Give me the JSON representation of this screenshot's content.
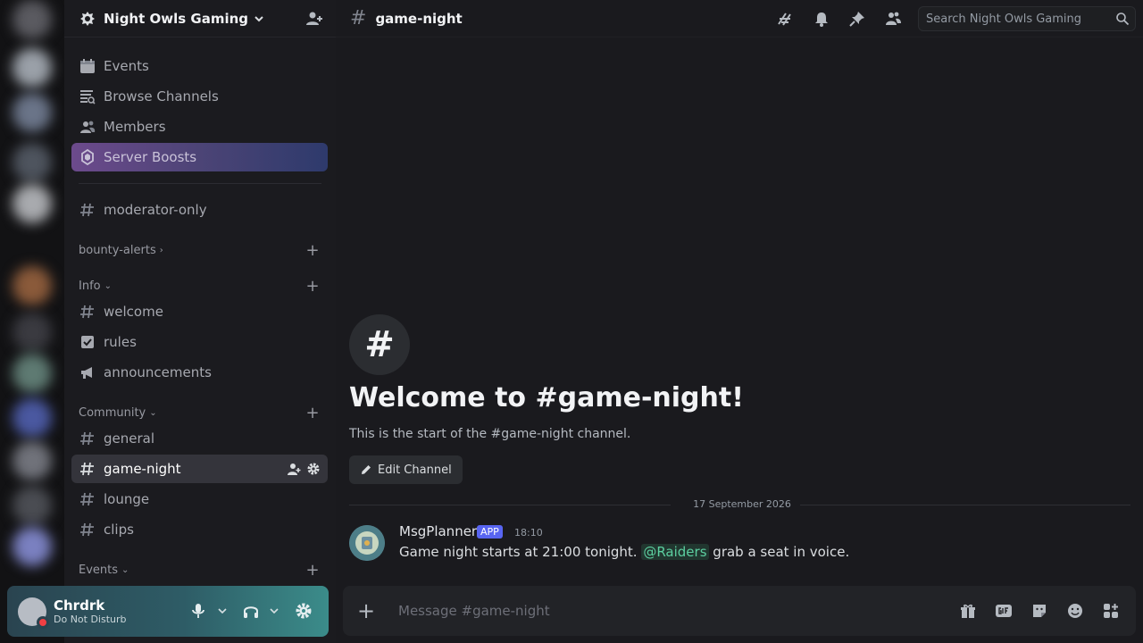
{
  "server": {
    "name": "Night Owls Gaming"
  },
  "nav": [
    {
      "label": "Events",
      "icon": "calendar-icon"
    },
    {
      "label": "Browse Channels",
      "icon": "browse-channels-icon"
    },
    {
      "label": "Members",
      "icon": "members-icon"
    },
    {
      "label": "Server Boosts",
      "icon": "boost-icon"
    }
  ],
  "channels": {
    "top": {
      "label": "moderator-only"
    },
    "categories": [
      {
        "label": "bounty-alerts",
        "chevron": "›"
      },
      {
        "label": "Info",
        "chevron": "⌄"
      },
      {
        "label": "Community",
        "chevron": "⌄"
      },
      {
        "label": "Events",
        "chevron": "⌄"
      }
    ],
    "info": [
      {
        "label": "welcome",
        "icon": "hash-icon"
      },
      {
        "label": "rules",
        "icon": "rules-icon"
      },
      {
        "label": "announcements",
        "icon": "megaphone-icon"
      }
    ],
    "community": [
      {
        "label": "general"
      },
      {
        "label": "game-night"
      },
      {
        "label": "lounge"
      },
      {
        "label": "clips"
      }
    ]
  },
  "user": {
    "name": "Chrdrk",
    "status": "Do Not Disturb"
  },
  "topbar": {
    "channel": "game-night",
    "search_placeholder": "Search Night Owls Gaming"
  },
  "welcome": {
    "hash": "#",
    "title": "Welcome to #game-night!",
    "subtitle": "This is the start of the #game-night channel.",
    "edit_label": "Edit Channel"
  },
  "date_divider": "17 September 2026",
  "message": {
    "author": "MsgPlanner",
    "badge": "APP",
    "time": "18:10",
    "text_before": "Game night starts at 21:00 tonight.",
    "mention": "@Raiders",
    "text_after": "grab a seat in voice."
  },
  "composer": {
    "placeholder": "Message #game-night"
  },
  "colors": {
    "boost_gradient_start": "#6c4a8c",
    "accent": "#5865f2",
    "dnd": "#f23f43",
    "panel_accent": "#3b8c8a"
  }
}
